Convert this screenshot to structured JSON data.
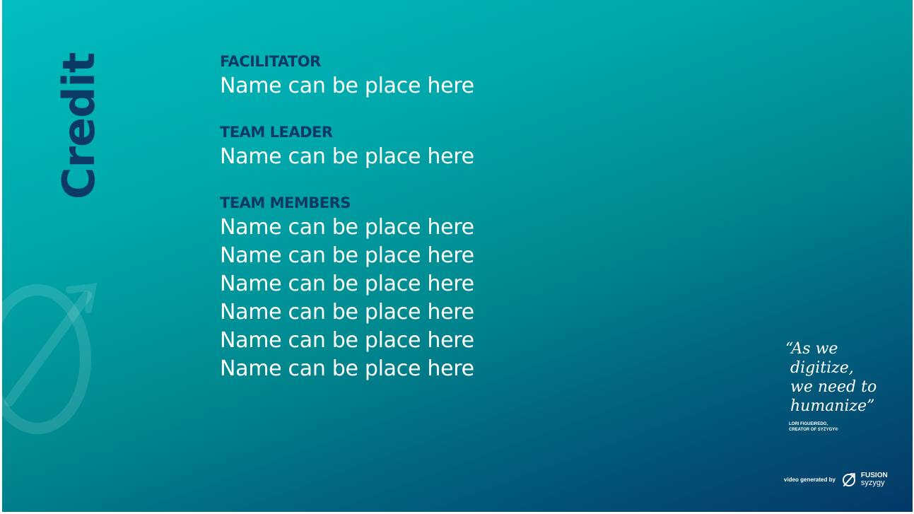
{
  "sidebar": {
    "title": "Credit"
  },
  "credits": {
    "facilitator": {
      "label": "FACILITATOR",
      "names": [
        "Name can be place here"
      ]
    },
    "team_leader": {
      "label": "TEAM LEADER",
      "names": [
        "Name can be place here"
      ]
    },
    "team_members": {
      "label": "TEAM MEMBERS",
      "names": [
        "Name can be place here",
        "Name can be place here",
        "Name can be place here",
        "Name can be place here",
        "Name can be place here",
        "Name can be place here"
      ]
    }
  },
  "quote": {
    "text": "“As we\n digitize,\n we need to\n humanize”",
    "attribution_line1": "LORI FIGUEIREDO,",
    "attribution_line2": "CREATOR OF SYZYGY®"
  },
  "footer": {
    "generated_by": "video generated by",
    "logo_line1": "FUSION",
    "logo_line2": "syzygy",
    "logo_icon": "null-set-circle-icon"
  },
  "colors": {
    "gradient_start": "#00bdbf",
    "gradient_end": "#043866",
    "heading": "#0b3a64",
    "text": "#ffffff"
  },
  "decor": {
    "watermark_icon": "circle-arrow-watermark-icon"
  }
}
